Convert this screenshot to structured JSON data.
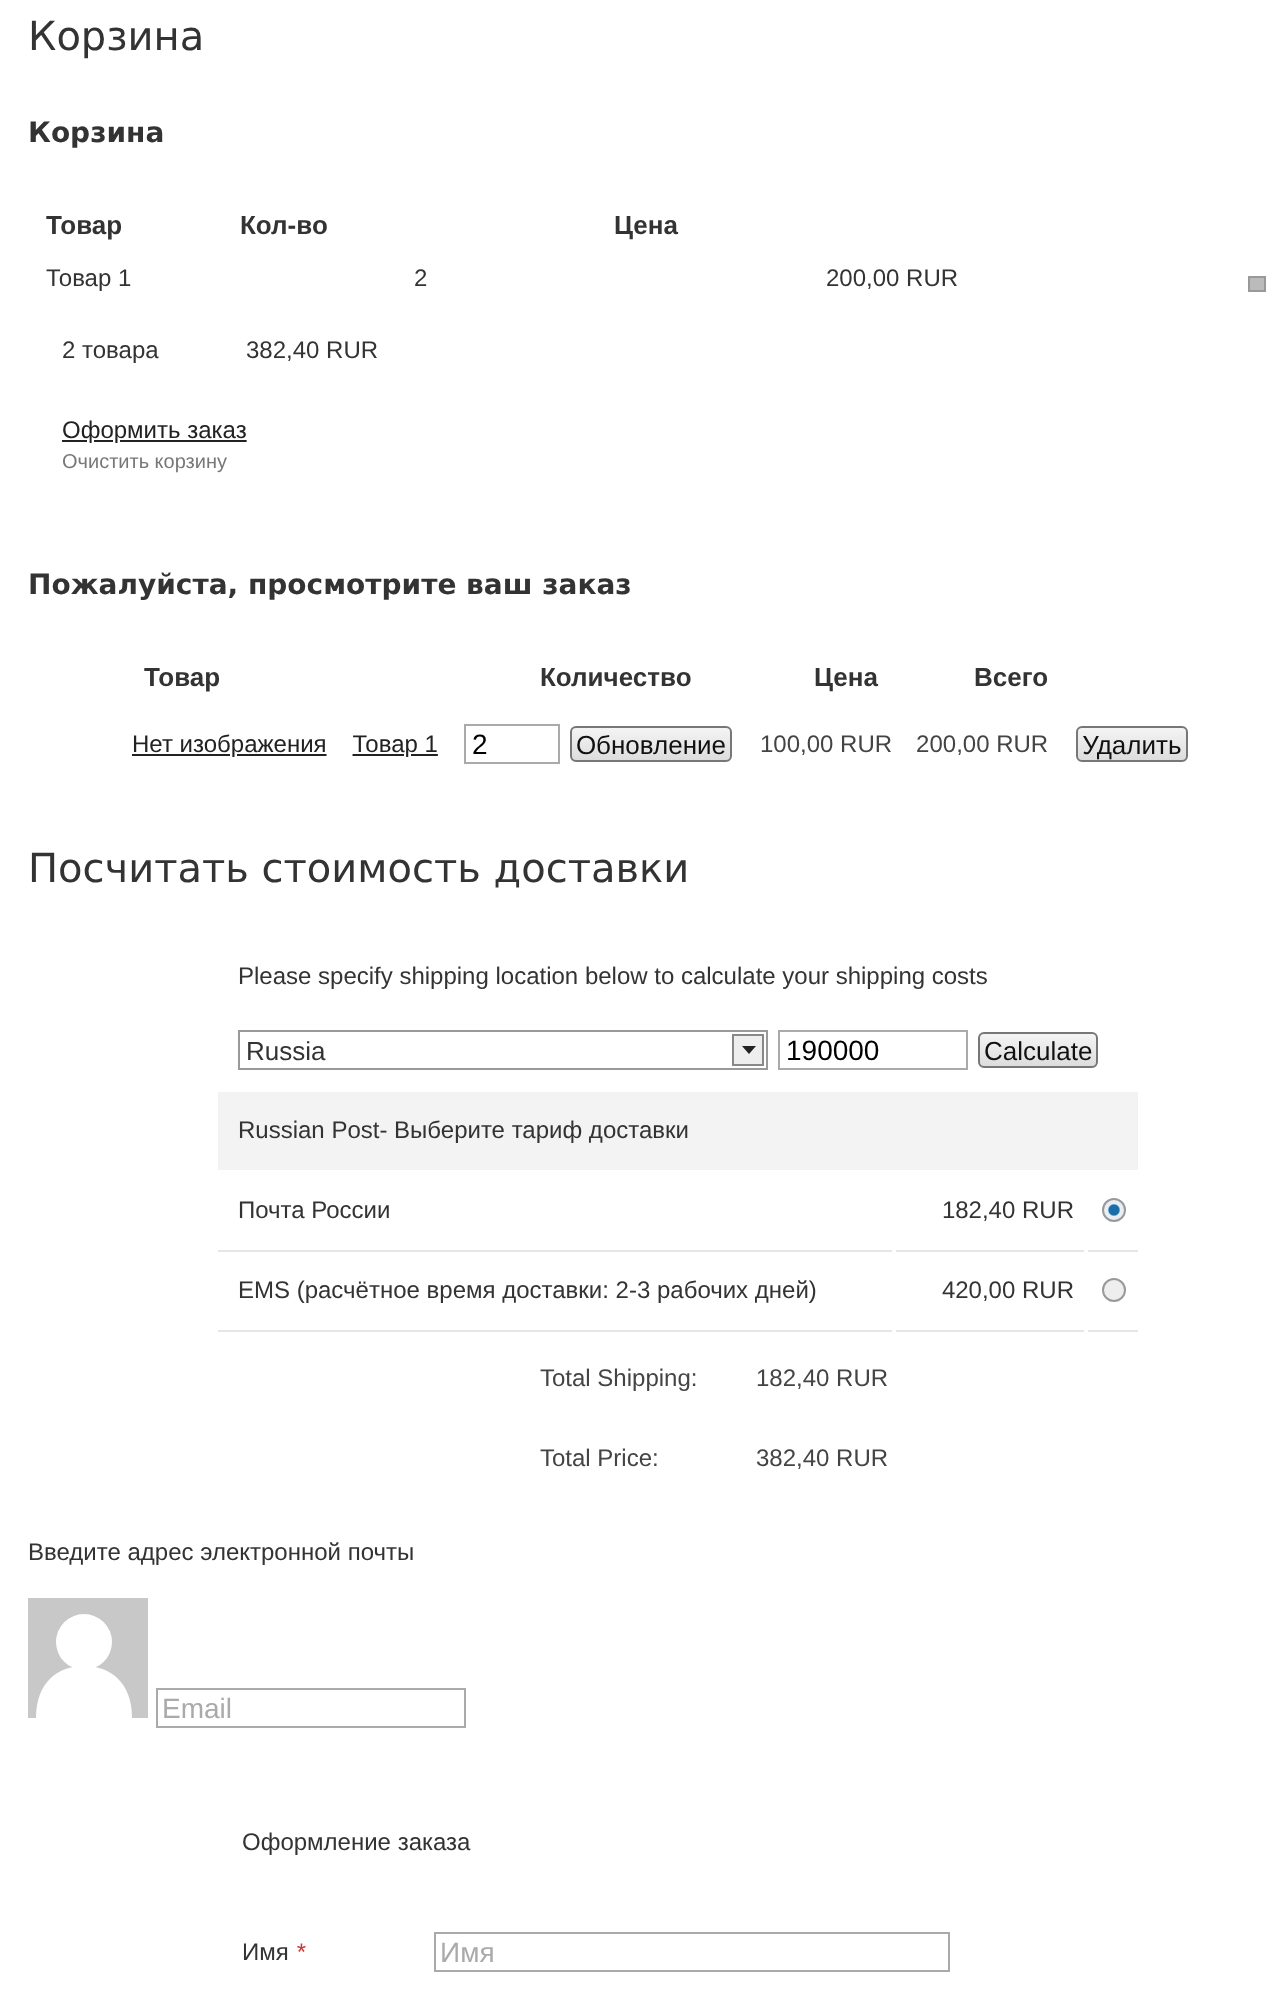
{
  "page_title": "Корзина",
  "cart": {
    "heading": "Корзина",
    "columns": [
      "Товар",
      "Кол-во",
      "Цена"
    ],
    "items": [
      {
        "name": "Товар 1",
        "qty": "2",
        "price": "200,00 RUR"
      }
    ],
    "count": "2 товара",
    "total": "382,40 RUR",
    "checkout_link": "Оформить заказ",
    "clear_link": "Очистить корзину"
  },
  "review": {
    "heading": "Пожалуйста, просмотрите ваш заказ",
    "columns": [
      "Товар",
      "Количество",
      "Цена",
      "Всего"
    ],
    "items": [
      {
        "image": "Нет изображения",
        "name": "Товар 1",
        "qty": "2",
        "update_button": "Обновление",
        "price": "100,00 RUR",
        "total": "200,00 RUR",
        "remove_button": "Удалить"
      }
    ]
  },
  "shipping": {
    "heading": "Посчитать стоимость доставки",
    "intro": "Please specify shipping location below to calculate your shipping costs",
    "country": "Russia",
    "zip": "190000",
    "calculate_button": "Calculate",
    "carrier": "Russian Post- Выберите тариф доставки",
    "options": [
      {
        "name": "Почта России",
        "price": "182,40 RUR",
        "selected": true
      },
      {
        "name": "EMS (расчётное время доставки: 2-3 рабочих дней)",
        "price": "420,00 RUR",
        "selected": false
      }
    ],
    "totals": [
      {
        "label": "Total Shipping:",
        "value": "182,40 RUR"
      },
      {
        "label": "Total Price:",
        "value": "382,40 RUR"
      }
    ]
  },
  "email": {
    "label": "Введите адрес электронной почты",
    "placeholder": "Email"
  },
  "checkout": {
    "heading": "Оформление заказа",
    "fields": [
      {
        "label": "Имя",
        "required_mark": "*",
        "placeholder": "Имя"
      }
    ]
  }
}
